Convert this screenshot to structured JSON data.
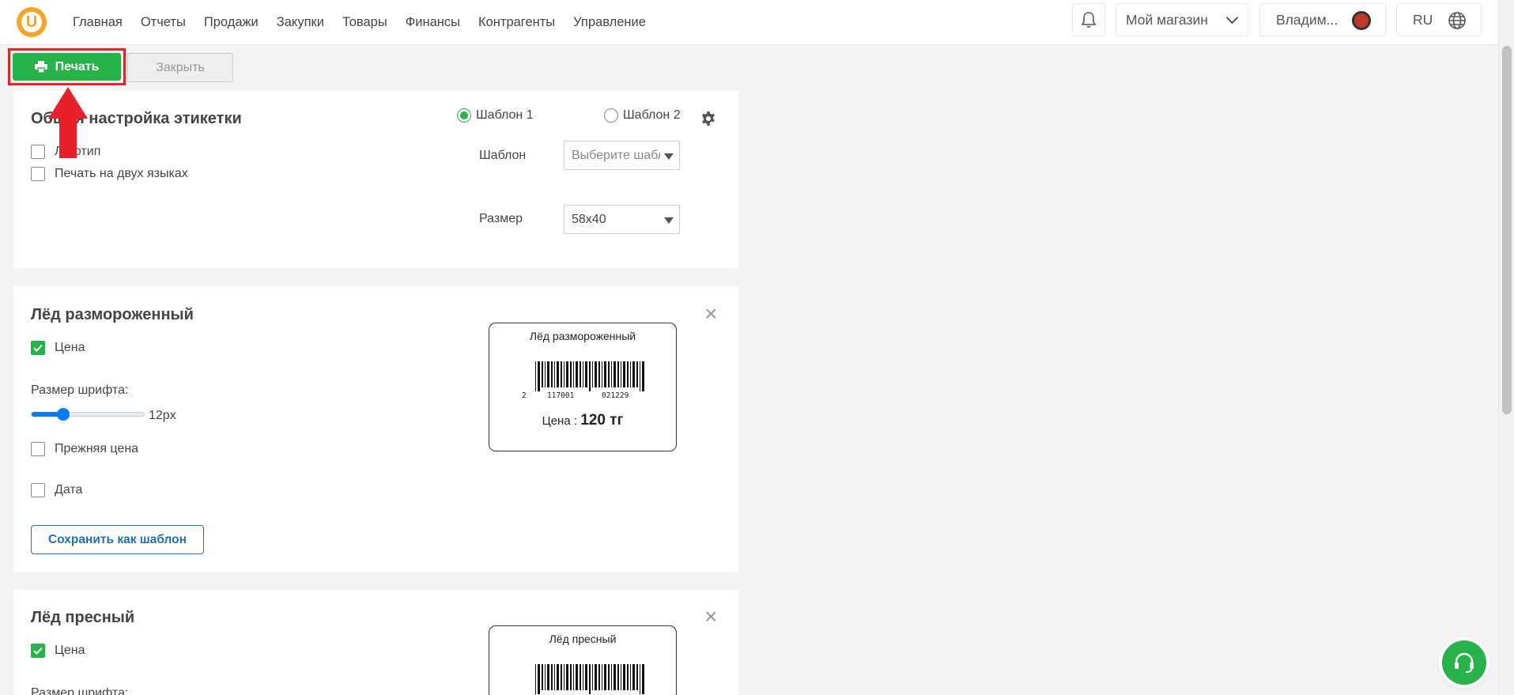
{
  "logo": {
    "text": "U"
  },
  "nav": [
    "Главная",
    "Отчеты",
    "Продажи",
    "Закупки",
    "Товары",
    "Финансы",
    "Контрагенты",
    "Управление"
  ],
  "header": {
    "store": "Мой магазин",
    "user": "Владим...",
    "lang": "RU"
  },
  "toolbar": {
    "print_label": "Печать",
    "close_label": "Закрыть"
  },
  "colors": {
    "accent": "#27b24a",
    "highlight": "#e8202a",
    "link": "#1f6fbf"
  },
  "settings": {
    "title": "Общая настройка этикетки",
    "logo_label": "Логотип",
    "two_lang_label": "Печать на двух языках",
    "template1": "Шаблон 1",
    "template2": "Шаблон 2",
    "template_label": "Шаблон",
    "template_placeholder": "Выберите шаблон",
    "size_label": "Размер",
    "size_value": "58x40"
  },
  "products": [
    {
      "title": "Лёд размороженный",
      "price_label": "Цена",
      "font_size_label": "Размер шрифта:",
      "font_size_value": "12px",
      "old_price_label": "Прежняя цена",
      "date_label": "Дата",
      "save_template_label": "Сохранить как шаблон",
      "label_name": "Лёд размороженный",
      "barcode_digits": [
        "2",
        "117001",
        "021229"
      ],
      "label_price_prefix": "Цена :",
      "label_price": "120 тг"
    },
    {
      "title": "Лёд пресный",
      "price_label": "Цена",
      "font_size_label": "Размер шрифта:",
      "label_name": "Лёд пресный"
    }
  ]
}
